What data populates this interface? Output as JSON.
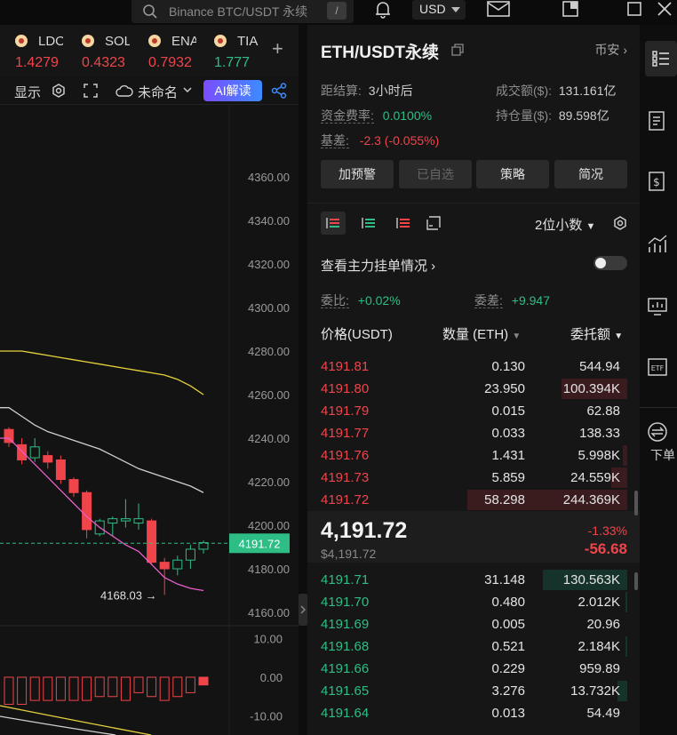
{
  "topbar": {
    "search_placeholder": "Binance BTC/USDT 永续",
    "search_shortcut": "/",
    "currency": "USD"
  },
  "tickers": [
    {
      "symbol": "LDO",
      "price": "1.4279",
      "color": "#f0444b"
    },
    {
      "symbol": "SOL",
      "price": "0.4323",
      "color": "#f0444b"
    },
    {
      "symbol": "ENA",
      "price": "0.7932",
      "color": "#f0444b"
    },
    {
      "symbol": "TIA",
      "price": "1.777",
      "color": "#2ebd85"
    }
  ],
  "tickers_add": "+",
  "chart_toolbar": {
    "display_label": "显示",
    "layout_name": "未命名",
    "ai_label": "AI解读"
  },
  "chart_data": {
    "type": "candlestick",
    "y_axis_ticks": [
      "4360.00",
      "4340.00",
      "4320.00",
      "4300.00",
      "4280.00",
      "4260.00",
      "4240.00",
      "4220.00",
      "4200.00",
      "4180.00",
      "4160.00"
    ],
    "ylim": [
      4160,
      4360
    ],
    "current_price_label": "4191.72",
    "low_annotation": "4168.03 →",
    "candles": [
      {
        "o": 4244,
        "h": 4245,
        "l": 4236,
        "c": 4238
      },
      {
        "o": 4237,
        "h": 4240,
        "l": 4228,
        "c": 4230
      },
      {
        "o": 4231,
        "h": 4240,
        "l": 4229,
        "c": 4236
      },
      {
        "o": 4232,
        "h": 4234,
        "l": 4226,
        "c": 4229
      },
      {
        "o": 4230,
        "h": 4232,
        "l": 4219,
        "c": 4221
      },
      {
        "o": 4221,
        "h": 4222,
        "l": 4213,
        "c": 4215
      },
      {
        "o": 4215,
        "h": 4216,
        "l": 4194,
        "c": 4198
      },
      {
        "o": 4196,
        "h": 4203,
        "l": 4195,
        "c": 4202
      },
      {
        "o": 4201,
        "h": 4204,
        "l": 4195,
        "c": 4203
      },
      {
        "o": 4202,
        "h": 4212,
        "l": 4199,
        "c": 4203
      },
      {
        "o": 4201,
        "h": 4210,
        "l": 4198,
        "c": 4203
      },
      {
        "o": 4202,
        "h": 4203,
        "l": 4182,
        "c": 4183
      },
      {
        "o": 4183,
        "h": 4185,
        "l": 4168,
        "c": 4180
      },
      {
        "o": 4180,
        "h": 4186,
        "l": 4177,
        "c": 4184
      },
      {
        "o": 4184,
        "h": 4191,
        "l": 4180,
        "c": 4189
      },
      {
        "o": 4189,
        "h": 4193,
        "l": 4187,
        "c": 4192
      }
    ],
    "ma_yellow": [
      4280,
      4280,
      4279,
      4278,
      4277,
      4276,
      4275,
      4274,
      4273,
      4272,
      4271,
      4270,
      4269,
      4267,
      4264,
      4260
    ],
    "ma_grey": [
      4254,
      4250,
      4246,
      4243,
      4241,
      4239,
      4237,
      4235,
      4232,
      4229,
      4226,
      4224,
      4222,
      4220,
      4218,
      4215
    ],
    "ma_pink": [
      4240,
      4234,
      4228,
      4222,
      4216,
      4210,
      4204,
      4199,
      4195,
      4191,
      4188,
      4182,
      4176,
      4173,
      4171,
      4170
    ],
    "indicator_ticks": [
      "10.00",
      "0.00",
      "-10.00"
    ],
    "macd_bars": [
      -7,
      -7,
      -6,
      -6,
      -6,
      -6,
      -6,
      -5,
      -5,
      -6,
      -4,
      -5,
      -6,
      -5,
      -4,
      -2
    ]
  },
  "panel": {
    "title": "ETH/USDT永续",
    "exchange": "币安",
    "settlement_label": "距结算:",
    "settlement_value": "3小时后",
    "volume_label": "成交额($):",
    "volume_value": "131.161亿",
    "funding_label": "资金费率:",
    "funding_value": "0.0100%",
    "oi_label": "持仓量($):",
    "oi_value": "89.598亿",
    "basis_label": "基差:",
    "basis_value": "-2.3 (-0.055%)",
    "buttons": [
      "加预警",
      "已自选",
      "策略",
      "简况"
    ],
    "decimals": "2位小数",
    "main_orders": "查看主力挂单情况",
    "ratio_label": "委比:",
    "ratio_value": "+0.02%",
    "diff_label": "委差:",
    "diff_value": "+9.947",
    "col_price": "价格(USDT)",
    "col_qty": "数量 (ETH)",
    "col_total": "委托额"
  },
  "asks": [
    {
      "price": "4191.81",
      "qty": "0.130",
      "total": "544.94",
      "depth": 0.0
    },
    {
      "price": "4191.80",
      "qty": "23.950",
      "total": "100.394K",
      "depth": 0.41
    },
    {
      "price": "4191.79",
      "qty": "0.015",
      "total": "62.88",
      "depth": 0.0
    },
    {
      "price": "4191.77",
      "qty": "0.033",
      "total": "138.33",
      "depth": 0.0
    },
    {
      "price": "4191.76",
      "qty": "1.431",
      "total": "5.998K",
      "depth": 0.03
    },
    {
      "price": "4191.73",
      "qty": "5.859",
      "total": "24.559K",
      "depth": 0.1
    },
    {
      "price": "4191.72",
      "qty": "58.298",
      "total": "244.369K",
      "depth": 1.0
    }
  ],
  "mid": {
    "price": "4,191.72",
    "usd": "$4,191.72",
    "pct": "-1.33%",
    "change": "-56.68"
  },
  "bids": [
    {
      "price": "4191.71",
      "qty": "31.148",
      "total": "130.563K",
      "depth": 0.53
    },
    {
      "price": "4191.70",
      "qty": "0.480",
      "total": "2.012K",
      "depth": 0.01
    },
    {
      "price": "4191.69",
      "qty": "0.005",
      "total": "20.96",
      "depth": 0.0
    },
    {
      "price": "4191.68",
      "qty": "0.521",
      "total": "2.184K",
      "depth": 0.01
    },
    {
      "price": "4191.66",
      "qty": "0.229",
      "total": "959.89",
      "depth": 0.0
    },
    {
      "price": "4191.65",
      "qty": "3.276",
      "total": "13.732K",
      "depth": 0.06
    },
    {
      "price": "4191.64",
      "qty": "0.013",
      "total": "54.49",
      "depth": 0.0
    }
  ],
  "sidebar": {
    "more_label": "下单"
  }
}
